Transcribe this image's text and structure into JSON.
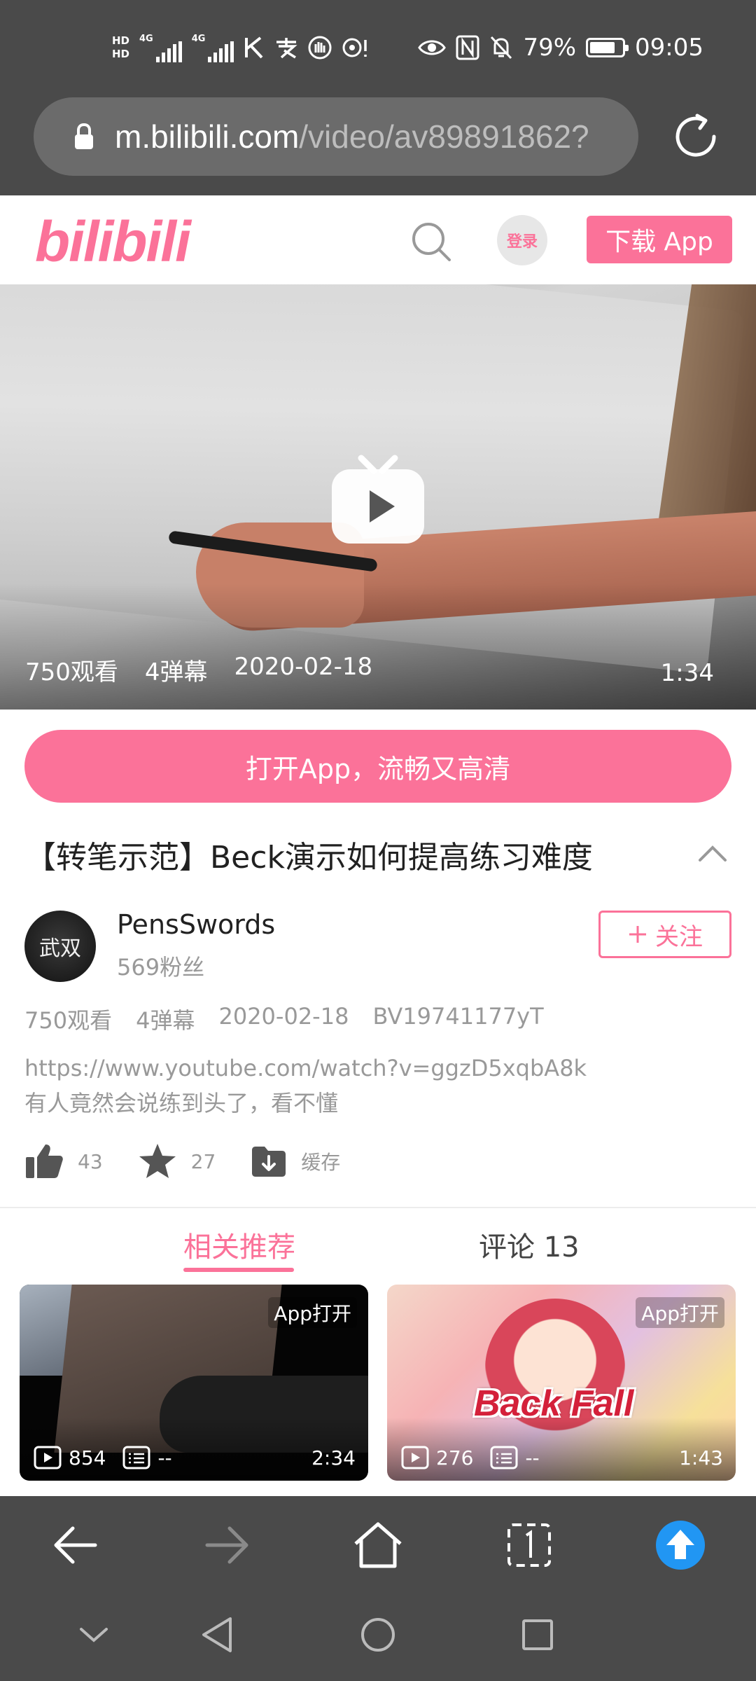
{
  "status_bar": {
    "hd1": "HD",
    "hd2": "HD",
    "net1": "4G",
    "net2": "4G",
    "battery_percent": "79%",
    "battery_level": 0.79,
    "time": "09:05"
  },
  "browser": {
    "url_host": "m.bilibili.com",
    "url_path": "/video/av89891862?"
  },
  "header": {
    "logo": "bilibili",
    "login_label": "登录",
    "download_label": "下载 App"
  },
  "video": {
    "views": "750观看",
    "danmaku": "4弹幕",
    "date": "2020-02-18",
    "duration": "1:34"
  },
  "open_app_label": "打开App，流畅又高清",
  "title": "【转笔示范】Beck演示如何提高练习难度",
  "uploader": {
    "name": "PensSwords",
    "fans": "569粉丝",
    "follow_label": "关注",
    "avatar_text": "武双"
  },
  "stats": {
    "views": "750观看",
    "danmaku": "4弹幕",
    "date": "2020-02-18",
    "bvid": "BV19741177yT"
  },
  "description": {
    "line1": "https://www.youtube.com/watch?v=ggzD5xqbA8k",
    "line2": "有人竟然会说练到头了，看不懂"
  },
  "actions": {
    "likes": "43",
    "favorites": "27",
    "cache_label": "缓存"
  },
  "tabs": {
    "related": "相关推荐",
    "comments": "评论 13"
  },
  "cards": [
    {
      "badge": "App打开",
      "plays": "854",
      "danmaku": "--",
      "duration": "2:34"
    },
    {
      "badge": "App打开",
      "plays": "276",
      "danmaku": "--",
      "duration": "1:43",
      "overlay_text": "Back Fall"
    }
  ],
  "colors": {
    "brand_pink": "#fb7299",
    "chrome_gray": "#4a4a4a",
    "upload_blue": "#2196f3"
  }
}
